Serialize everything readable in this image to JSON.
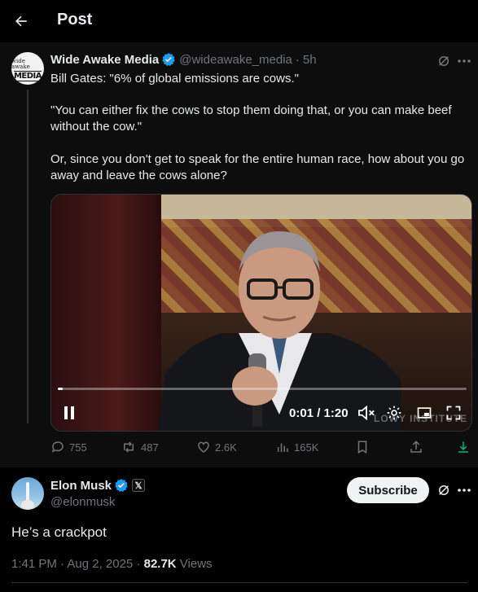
{
  "header": {
    "title": "Post"
  },
  "quoted_post": {
    "avatar": {
      "top": "wide awake",
      "bottom": "MEDIA"
    },
    "author_name": "Wide Awake Media",
    "handle": "@wideawake_media",
    "separator": "·",
    "time": "5h",
    "text_lines": [
      "Bill Gates: \"6% of global emissions are cows.\"",
      "\"You can either fix the cows to stop them doing that, or you can make beef without the cow.\"",
      "Or, since you don't get to speak for the entire human race, how about you go away and leave the cows alone?"
    ],
    "video": {
      "time_display": "0:01 / 1:20",
      "watermark": "LOWY INSTITUTE",
      "progress": 0.0125
    },
    "actions": {
      "replies": "755",
      "reposts": "487",
      "likes": "2.6K",
      "views": "165K"
    }
  },
  "main_post": {
    "author_name": "Elon Musk",
    "affiliate_badge": "𝕏",
    "handle": "@elonmusk",
    "subscribe_label": "Subscribe",
    "text": "He’s a crackpot",
    "timestamp": "1:41 PM · Aug 2, 2025 · ",
    "views_count": "82.7K",
    "views_label": " Views"
  },
  "colors": {
    "background": "#000000",
    "text": "#e7e9ea",
    "muted": "#71767b",
    "verified": "#1d9bf0",
    "border": "#2f3336"
  },
  "icons": [
    "back-arrow-icon",
    "verified-icon",
    "grok-icon",
    "more-icon",
    "pause-icon",
    "volume-mute-icon",
    "settings-icon",
    "pip-icon",
    "fullscreen-icon",
    "reply-icon",
    "repost-icon",
    "like-icon",
    "views-icon",
    "bookmark-icon",
    "share-icon",
    "download-icon",
    "x-affiliate-icon"
  ]
}
